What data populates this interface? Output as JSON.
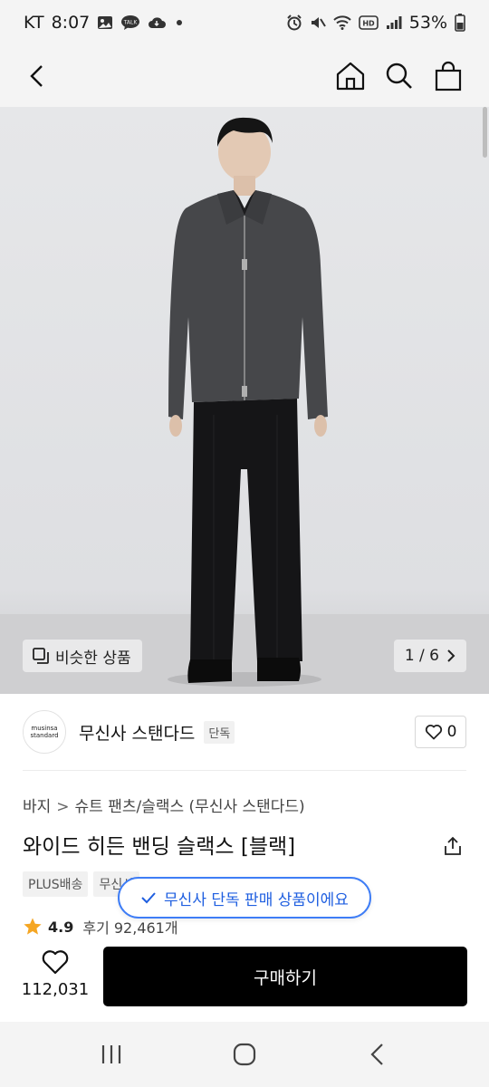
{
  "status_bar": {
    "carrier": "KT",
    "time": "8:07",
    "talk_label": "TALK",
    "hd_label": "HD",
    "battery": "53%"
  },
  "gallery": {
    "similar_label": "비슷한 상품",
    "counter": "1 / 6"
  },
  "brand": {
    "logo_line1": "musinsa",
    "logo_line2": "standard",
    "name": "무신사 스탠다드",
    "badge": "단독",
    "like_count": "0"
  },
  "breadcrumb": {
    "items": [
      "바지",
      "슈트 팬츠/슬랙스 (무신사 스탠다드)"
    ],
    "separator": ">"
  },
  "product": {
    "title": "와이드 히든 밴딩 슬랙스 [블랙]"
  },
  "tags": [
    "PLUS배송",
    "무신사"
  ],
  "rating": {
    "score": "4.9",
    "review_text": "후기 92,461개"
  },
  "toast": {
    "text": "무신사 단독 판매 상품이에요"
  },
  "buy_bar": {
    "wish_count": "112,031",
    "buy_label": "구매하기"
  },
  "colors": {
    "accent_blue": "#3e7df6",
    "buy_button": "#000000",
    "star": "#f5a623"
  }
}
